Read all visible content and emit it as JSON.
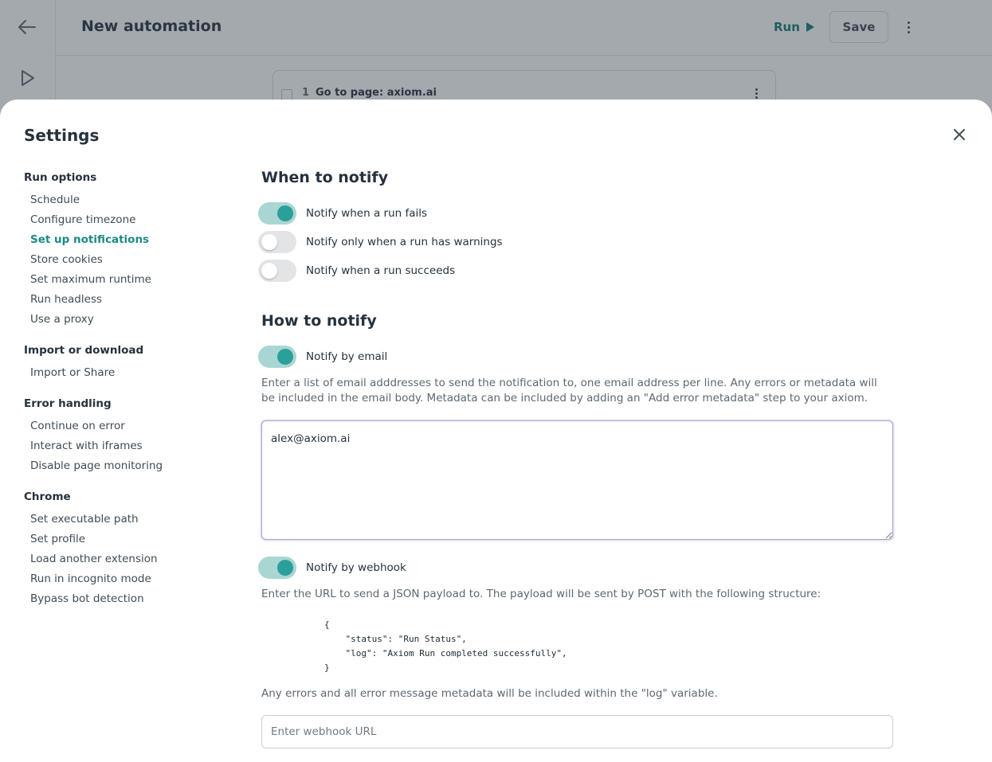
{
  "app": {
    "title": "New automation",
    "run_label": "Run",
    "save_label": "Save",
    "step": {
      "number": "1",
      "label": "Go to page: axiom.ai"
    }
  },
  "settings": {
    "title": "Settings",
    "sidebar": [
      {
        "heading": "Run options",
        "items": [
          "Schedule",
          "Configure timezone",
          "Set up notifications",
          "Store cookies",
          "Set maximum runtime",
          "Run headless",
          "Use a proxy"
        ]
      },
      {
        "heading": "Import or download",
        "items": [
          "Import or Share"
        ]
      },
      {
        "heading": "Error handling",
        "items": [
          "Continue on error",
          "Interact with iframes",
          "Disable page monitoring"
        ]
      },
      {
        "heading": "Chrome",
        "items": [
          "Set executable path",
          "Set profile",
          "Load another extension",
          "Run in incognito mode",
          "Bypass bot detection"
        ]
      }
    ],
    "active_item": "Set up notifications",
    "when": {
      "title": "When to notify",
      "toggles": [
        {
          "label": "Notify when a run fails",
          "on": true
        },
        {
          "label": "Notify only when a run has warnings",
          "on": false
        },
        {
          "label": "Notify when a run succeeds",
          "on": false
        }
      ]
    },
    "how": {
      "title": "How to notify",
      "email": {
        "label": "Notify by email",
        "on": true,
        "description": "Enter a list of email adddresses to send the notification to, one email address per line. Any errors or metadata will be included in the email body. Metadata can be included by adding an \"Add error metadata\" step to your axiom.",
        "value": "alex@axiom.ai"
      },
      "webhook": {
        "label": "Notify by webhook",
        "on": true,
        "description": "Enter the URL to send a JSON payload to. The payload will be sent by POST with the following structure:",
        "payload": "{\n    \"status\": \"Run Status\",\n    \"log\": \"Axiom Run completed successfully\",\n}",
        "note": "Any errors and all error message metadata will be included within the \"log\" variable.",
        "placeholder": "Enter webhook URL"
      }
    }
  },
  "colors": {
    "accent": "#2b9f99",
    "accent_light": "#a9d6d3",
    "active_text": "#1c8a85"
  }
}
